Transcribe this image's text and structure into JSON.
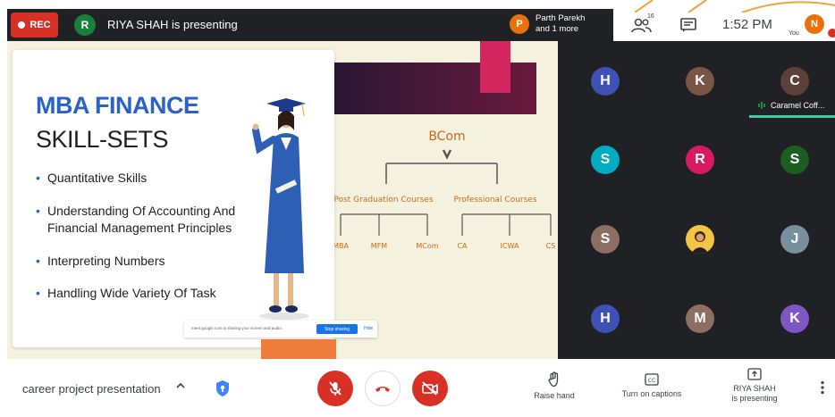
{
  "top_bar": {
    "rec_label": "REC",
    "presenter_initial": "R",
    "presenting_text": "RIYA SHAH is presenting",
    "participant_initial": "P",
    "participant_line1": "Parth Parekh",
    "participant_line2": "and 1 more",
    "people_count": "16",
    "time": "1:52 PM",
    "self_initial": "N",
    "self_label": "You"
  },
  "slide": {
    "title_line1": "MBA FINANCE",
    "title_line2": "SKILL-SETS",
    "bullets": [
      "Quantitative Skills",
      "Understanding Of Accounting And Financial Management Principles",
      "Interpreting Numbers",
      "Handling Wide Variety Of Task"
    ],
    "diagram": {
      "root": "BCom",
      "branch_left": "Post Graduation Courses",
      "branch_right": "Professional Courses",
      "leaves_left": [
        "MBA",
        "MFM",
        "MCom"
      ],
      "leaves_right": [
        "CA",
        "ICWA",
        "CS"
      ]
    },
    "share_banner": {
      "text": "meet.google.com is sharing your screen and audio.",
      "stop_label": "Stop sharing",
      "hide_label": "Hide"
    }
  },
  "participants": [
    {
      "initial": "H",
      "color": "#3f51b5"
    },
    {
      "initial": "K",
      "color": "#795548"
    },
    {
      "initial": "C",
      "color": "#5d4037",
      "name": "Caramel Coff..."
    },
    {
      "initial": "S",
      "color": "#00acc1"
    },
    {
      "initial": "R",
      "color": "#d81b60"
    },
    {
      "initial": "S",
      "color": "#1b5e20"
    },
    {
      "initial": "S",
      "color": "#8d6e63"
    },
    {
      "initial": "",
      "color": "#f4c542",
      "photo": true
    },
    {
      "initial": "J",
      "color": "#78909c"
    },
    {
      "initial": "H",
      "color": "#3f51b5"
    },
    {
      "initial": "M",
      "color": "#8d6e63"
    },
    {
      "initial": "K",
      "color": "#7e57c2"
    }
  ],
  "bottom_bar": {
    "meeting_name": "career project presentation",
    "raise_hand_label": "Raise hand",
    "captions_label": "Turn on captions",
    "presenting_line1": "RIYA SHAH",
    "presenting_line2": "is presenting"
  },
  "colors": {
    "accent_red": "#d93025",
    "slide_title_blue": "#2b62c9",
    "diagram_orange": "#c66c17",
    "tile_background": "#202124"
  }
}
